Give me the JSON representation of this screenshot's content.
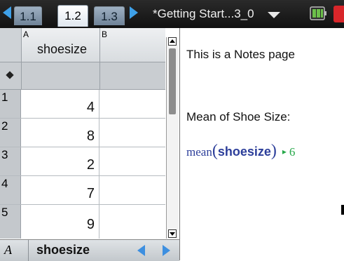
{
  "tabs": [
    {
      "label": "1.1"
    },
    {
      "label": "1.2",
      "active": true
    },
    {
      "label": "1.3"
    }
  ],
  "document": {
    "title": "*Getting Start...3_0"
  },
  "spreadsheet": {
    "columns": [
      {
        "letter": "A",
        "name": "shoesize"
      },
      {
        "letter": "B",
        "name": ""
      }
    ],
    "rows": [
      {
        "num": "1",
        "a": "4"
      },
      {
        "num": "2",
        "a": "8"
      },
      {
        "num": "3",
        "a": "2"
      },
      {
        "num": "4",
        "a": "7"
      },
      {
        "num": "5",
        "a": "9"
      }
    ],
    "status": {
      "cell_ref": "A",
      "variable": "shoesize"
    }
  },
  "notes": {
    "line1": "This is a Notes page",
    "line2": "Mean of Shoe Size:",
    "math": {
      "function": "mean",
      "open_paren": "(",
      "argument": "shoesize",
      "close_paren": ")",
      "arrow": "▸",
      "result": "6"
    }
  },
  "colors": {
    "accent_blue": "#3ea0e8",
    "math_blue": "#2c3e9a",
    "result_green": "#27a84a",
    "close_red": "#d8262a"
  },
  "icons": [
    "nav-left-arrow-icon",
    "nav-right-arrow-icon",
    "dropdown-triangle-icon",
    "battery-icon",
    "close-icon",
    "scroll-up-icon",
    "scroll-down-icon",
    "page-left-arrow-icon",
    "page-right-arrow-icon"
  ]
}
